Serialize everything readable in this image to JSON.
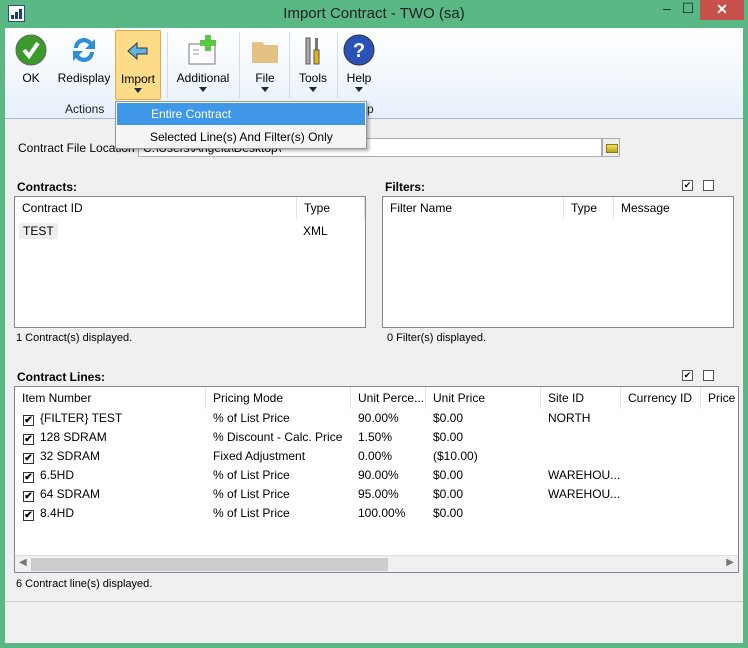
{
  "window": {
    "title": "Import Contract  -  TWO (sa)",
    "minimize": "–",
    "maximize": "☐",
    "close": "✕"
  },
  "ribbon": {
    "buttons": [
      {
        "label": "OK",
        "icon": "ok-check-icon"
      },
      {
        "label": "Redisplay",
        "icon": "refresh-icon"
      },
      {
        "label": "Import",
        "icon": "import-arrow-icon"
      },
      {
        "label": "Additional",
        "icon": "additional-icon"
      },
      {
        "label": "File",
        "icon": "folder-icon"
      },
      {
        "label": "Tools",
        "icon": "tools-icon"
      },
      {
        "label": "Help",
        "icon": "help-icon"
      }
    ],
    "group_actions": "Actions",
    "group_help": "p"
  },
  "import_menu": {
    "items": [
      "Entire Contract",
      "Selected Line(s) And Filter(s) Only"
    ]
  },
  "file_location": {
    "label": "Contract File Location",
    "value": "C:\\Users\\Angela\\Desktop\\"
  },
  "contracts": {
    "title": "Contracts:",
    "columns": [
      "Contract ID",
      "Type"
    ],
    "rows": [
      [
        "TEST",
        "XML"
      ]
    ],
    "status": "1 Contract(s) displayed."
  },
  "filters": {
    "title": "Filters:",
    "columns": [
      "Filter Name",
      "Type",
      "Message"
    ],
    "rows": [],
    "status": "0 Filter(s) displayed."
  },
  "lines": {
    "title": "Contract Lines:",
    "columns": [
      "Item Number",
      "Pricing Mode",
      "Unit Perce...",
      "Unit Price",
      "Site ID",
      "Currency ID",
      "Price"
    ],
    "rows": [
      {
        "checked": true,
        "cells": [
          "{FILTER} TEST",
          "% of List Price",
          "90.00%",
          "$0.00",
          "NORTH",
          "",
          ""
        ]
      },
      {
        "checked": true,
        "cells": [
          "128 SDRAM",
          "% Discount - Calc. Price",
          "1.50%",
          "$0.00",
          "",
          "",
          ""
        ]
      },
      {
        "checked": true,
        "cells": [
          "32 SDRAM",
          "Fixed Adjustment",
          "0.00%",
          "($10.00)",
          "",
          "",
          ""
        ]
      },
      {
        "checked": true,
        "cells": [
          "6.5HD",
          "% of List Price",
          "90.00%",
          "$0.00",
          "WAREHOU...",
          "",
          ""
        ]
      },
      {
        "checked": true,
        "cells": [
          "64 SDRAM",
          "% of List Price",
          "95.00%",
          "$0.00",
          "WAREHOU...",
          "",
          ""
        ]
      },
      {
        "checked": true,
        "cells": [
          "8.4HD",
          "% of List Price",
          "100.00%",
          "$0.00",
          "",
          "",
          ""
        ]
      }
    ],
    "status": "6 Contract line(s) displayed."
  },
  "colors": {
    "title_bar": "#5ab885",
    "close": "#c7504b",
    "menu_highlight": "#3f97e8",
    "import_active": "#fddc87"
  }
}
